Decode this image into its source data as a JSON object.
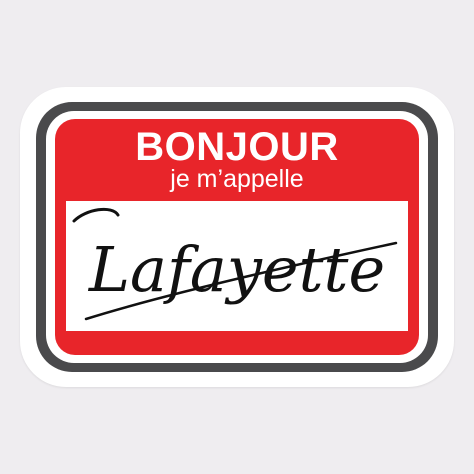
{
  "sticker": {
    "headline": "BONJOUR",
    "subline": "je m’appelle",
    "name": "Lafayette"
  },
  "colors": {
    "background": "#efedf0",
    "tag_red": "#e8252a",
    "rim_grey": "#4a4a4c",
    "ink": "#111111"
  }
}
